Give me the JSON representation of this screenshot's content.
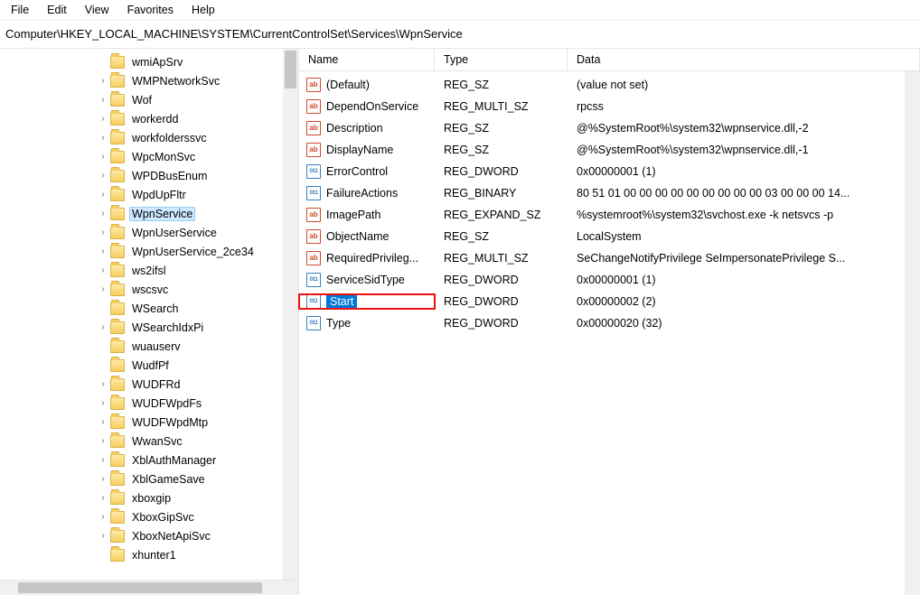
{
  "menu": {
    "file": "File",
    "edit": "Edit",
    "view": "View",
    "favorites": "Favorites",
    "help": "Help"
  },
  "address": "Computer\\HKEY_LOCAL_MACHINE\\SYSTEM\\CurrentControlSet\\Services\\WpnService",
  "tree": {
    "items": [
      {
        "label": "wmiApSrv",
        "exp": false
      },
      {
        "label": "WMPNetworkSvc",
        "exp": true
      },
      {
        "label": "Wof",
        "exp": true
      },
      {
        "label": "workerdd",
        "exp": true
      },
      {
        "label": "workfolderssvc",
        "exp": true
      },
      {
        "label": "WpcMonSvc",
        "exp": true
      },
      {
        "label": "WPDBusEnum",
        "exp": true
      },
      {
        "label": "WpdUpFltr",
        "exp": true
      },
      {
        "label": "WpnService",
        "exp": true,
        "selected": true
      },
      {
        "label": "WpnUserService",
        "exp": true
      },
      {
        "label": "WpnUserService_2ce34",
        "exp": true
      },
      {
        "label": "ws2ifsl",
        "exp": true
      },
      {
        "label": "wscsvc",
        "exp": true
      },
      {
        "label": "WSearch",
        "exp": false
      },
      {
        "label": "WSearchIdxPi",
        "exp": true
      },
      {
        "label": "wuauserv",
        "exp": false
      },
      {
        "label": "WudfPf",
        "exp": false
      },
      {
        "label": "WUDFRd",
        "exp": true
      },
      {
        "label": "WUDFWpdFs",
        "exp": true
      },
      {
        "label": "WUDFWpdMtp",
        "exp": true
      },
      {
        "label": "WwanSvc",
        "exp": true
      },
      {
        "label": "XblAuthManager",
        "exp": true
      },
      {
        "label": "XblGameSave",
        "exp": true
      },
      {
        "label": "xboxgip",
        "exp": true
      },
      {
        "label": "XboxGipSvc",
        "exp": true
      },
      {
        "label": "XboxNetApiSvc",
        "exp": true
      },
      {
        "label": "xhunter1",
        "exp": false
      }
    ]
  },
  "headers": {
    "name": "Name",
    "type": "Type",
    "data": "Data"
  },
  "values": [
    {
      "icon": "sz",
      "name": "(Default)",
      "type": "REG_SZ",
      "data": "(value not set)"
    },
    {
      "icon": "sz",
      "name": "DependOnService",
      "type": "REG_MULTI_SZ",
      "data": "rpcss"
    },
    {
      "icon": "sz",
      "name": "Description",
      "type": "REG_SZ",
      "data": "@%SystemRoot%\\system32\\wpnservice.dll,-2"
    },
    {
      "icon": "sz",
      "name": "DisplayName",
      "type": "REG_SZ",
      "data": "@%SystemRoot%\\system32\\wpnservice.dll,-1"
    },
    {
      "icon": "bin",
      "name": "ErrorControl",
      "type": "REG_DWORD",
      "data": "0x00000001 (1)"
    },
    {
      "icon": "bin",
      "name": "FailureActions",
      "type": "REG_BINARY",
      "data": "80 51 01 00 00 00 00 00 00 00 00 00 03 00 00 00 14..."
    },
    {
      "icon": "sz",
      "name": "ImagePath",
      "type": "REG_EXPAND_SZ",
      "data": "%systemroot%\\system32\\svchost.exe -k netsvcs -p"
    },
    {
      "icon": "sz",
      "name": "ObjectName",
      "type": "REG_SZ",
      "data": "LocalSystem"
    },
    {
      "icon": "sz",
      "name": "RequiredPrivileg...",
      "type": "REG_MULTI_SZ",
      "data": "SeChangeNotifyPrivilege SeImpersonatePrivilege S..."
    },
    {
      "icon": "bin",
      "name": "ServiceSidType",
      "type": "REG_DWORD",
      "data": "0x00000001 (1)"
    },
    {
      "icon": "bin",
      "name": "Start",
      "type": "REG_DWORD",
      "data": "0x00000002 (2)",
      "selected": true
    },
    {
      "icon": "bin",
      "name": "Type",
      "type": "REG_DWORD",
      "data": "0x00000020 (32)"
    }
  ],
  "iconGlyph": {
    "sz": "ab",
    "bin": "011\n110"
  }
}
